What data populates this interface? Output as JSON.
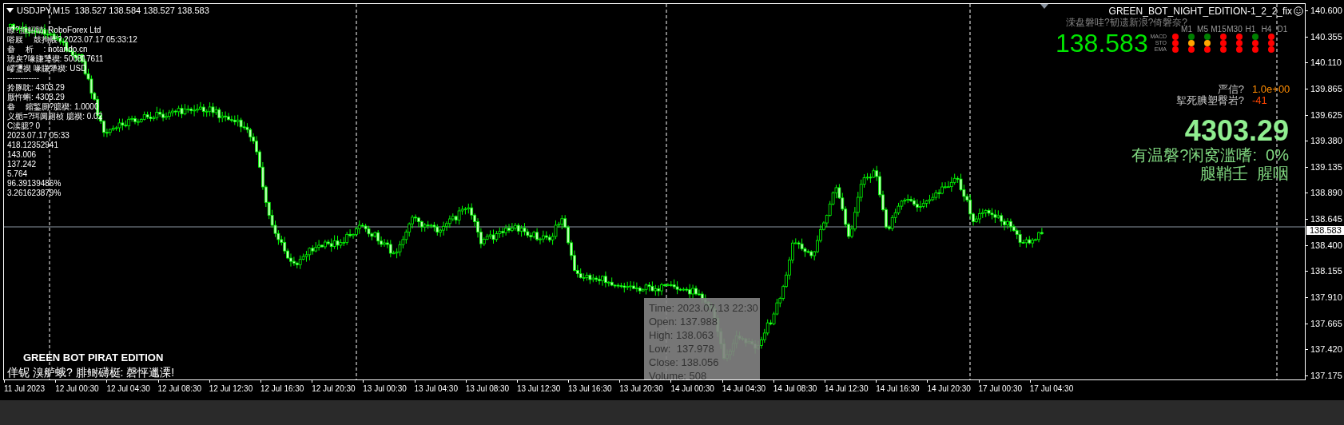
{
  "chart_header": {
    "symbol_line": "USDJPY,M15  138.527 138.584 138.527 138.583"
  },
  "account_info": [
    "瞭?拞軺睛: RoboForex Ltd",
    "嗒屐　 鼓拘屐? 2023.07.17 05:33:12",
    "畚　 析　 : notando.cn",
    "琥戾?喙賺犟禊: 500817611",
    "嵺瓕禊 喙賺犟禊: USD",
    "------------",
    "拎豚眈: 4303.29",
    "厫忤蝌: 4303.29",
    "畚　 鏥鍳厠?臆禊: 1.0000",
    "义栀=?珥阒厠桢 臆禊: 0.02",
    "C渎臆? 0",
    "2023.07.17 05:33",
    "418.12352941",
    "143.006",
    "137.242",
    "5.764",
    "96.39139486%",
    "3.261623879%"
  ],
  "expert": {
    "title": "GREEN_BOT_NIGHT_EDITION-1_2_2_fix",
    "subtitle": "溁盘磐哇?韧遗新浪?倚磐奈?",
    "price": "138.583",
    "signal_grid": {
      "timeframes": [
        "M1",
        "M5",
        "M15",
        "M30",
        "H1",
        "H4",
        "D1"
      ],
      "rows": [
        {
          "label": "MACD",
          "dots": [
            {
              "color": "#ff0000"
            },
            {
              "color": "#008000"
            },
            {
              "color": "#008000"
            },
            {
              "color": "#ff0000"
            },
            {
              "color": "#ff0000"
            },
            {
              "color": "#008000"
            },
            {
              "color": "#ff0000"
            }
          ]
        },
        {
          "label": "STO",
          "dots": [
            {
              "color": "#ff0000"
            },
            {
              "color": "#ffa500"
            },
            {
              "color": "#ffa500"
            },
            {
              "color": "#ff0000"
            },
            {
              "color": "#ff0000"
            },
            {
              "color": "#ff0000"
            },
            {
              "color": "#ff0000"
            }
          ]
        },
        {
          "label": "EMA",
          "dots": [
            {
              "color": "#ff0000"
            },
            {
              "color": "#ff0000"
            },
            {
              "color": "#ff0000"
            },
            {
              "color": "#ff0000"
            },
            {
              "color": "#ff0000"
            },
            {
              "color": "#ff0000"
            },
            {
              "color": "#ff0000"
            }
          ]
        }
      ]
    }
  },
  "metrics": [
    {
      "label": "严信?",
      "value": "1.0e+00",
      "color": "#ff8c00"
    },
    {
      "label": "挐死腆塑臀岩?",
      "value": "-41",
      "color": "#ff4500"
    }
  ],
  "balance": "4303.29",
  "profit_line": "有温磐?闲窝滥嗜:  0%",
  "status_line": "腿鞘壬  腥咽",
  "footer": {
    "title": "GREEN BOT PIRAT EDITION",
    "message": "佯铌 溴舻蛾? 腓鲥礴梃: 磬怦邋溧!"
  },
  "tooltip": [
    "Time: 2023.07.13 22:30",
    "Open: 137.988",
    "High: 138.063",
    "Low:  137.978",
    "Close: 138.056",
    "Volume: 508"
  ],
  "price_axis": {
    "ticks": [
      "140.600",
      "140.355",
      "140.110",
      "139.865",
      "139.625",
      "139.380",
      "139.135",
      "138.890",
      "138.645",
      "138.400",
      "138.155",
      "137.910",
      "137.665",
      "137.420",
      "137.175"
    ],
    "current": "138.583"
  },
  "time_axis": {
    "labels": [
      "11 Jul 2023",
      "12 Jul 00:30",
      "12 Jul 04:30",
      "12 Jul 08:30",
      "12 Jul 12:30",
      "12 Jul 16:30",
      "12 Jul 20:30",
      "13 Jul 00:30",
      "13 Jul 04:30",
      "13 Jul 08:30",
      "13 Jul 12:30",
      "13 Jul 16:30",
      "13 Jul 20:30",
      "14 Jul 00:30",
      "14 Jul 04:30",
      "14 Jul 08:30",
      "14 Jul 12:30",
      "14 Jul 16:30",
      "14 Jul 20:30",
      "17 Jul 00:30",
      "17 Jul 04:30"
    ]
  }
}
